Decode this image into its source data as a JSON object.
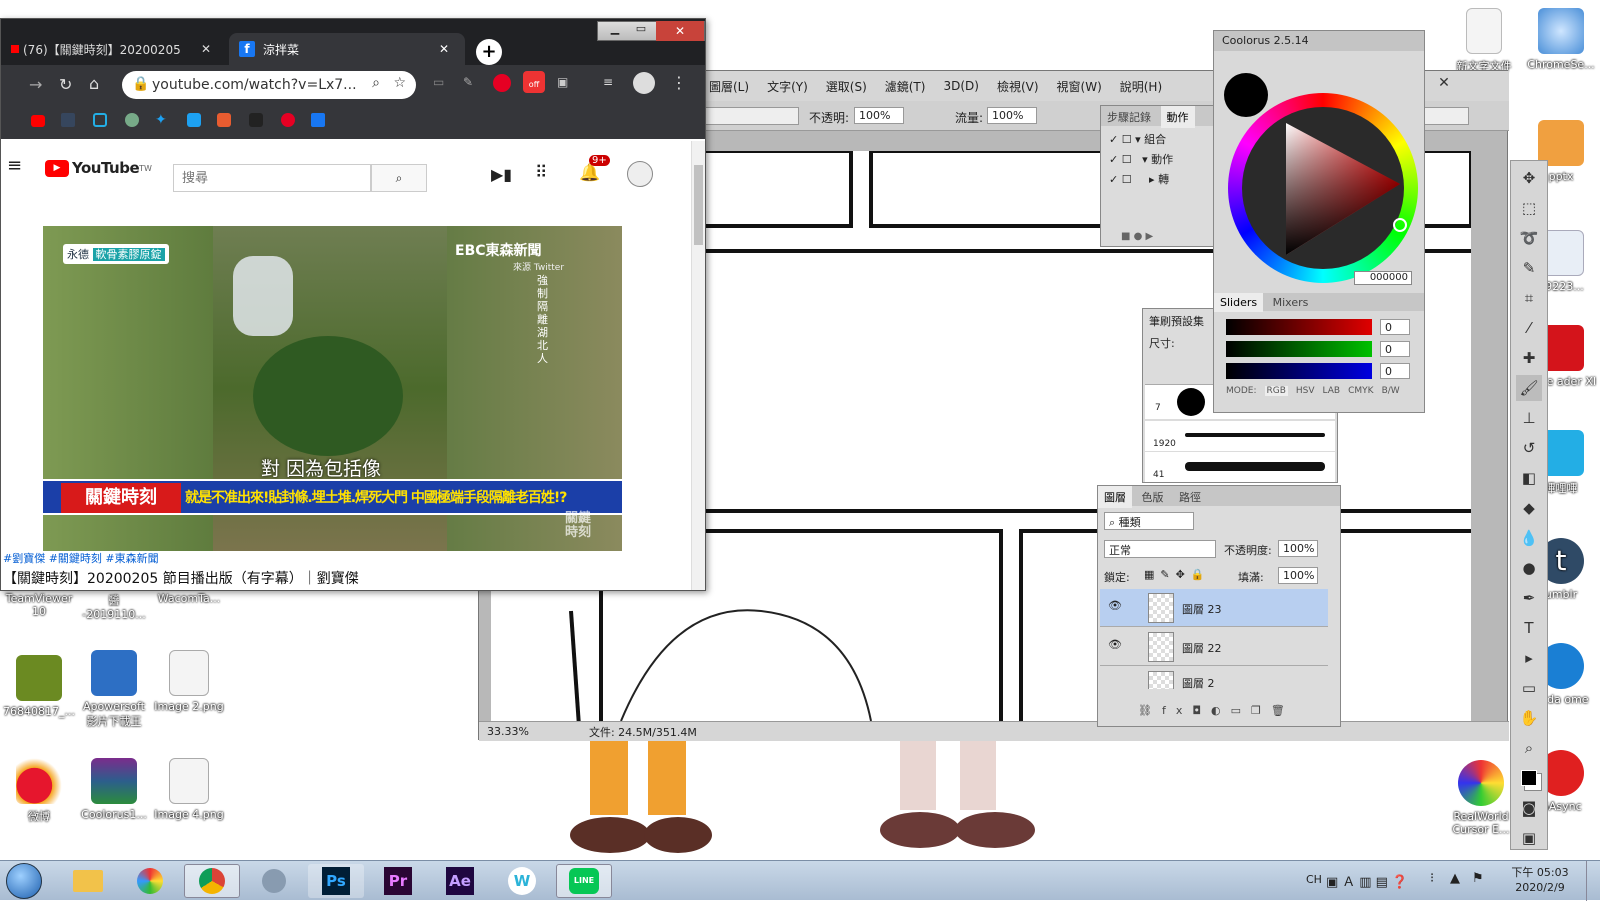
{
  "desktop": {
    "icons_right": [
      {
        "label": "新文字文件"
      },
      {
        "label": "ChromeSe..."
      }
    ],
    "icons_right_partial": [
      "2019110...",
      "pptx",
      "39223...",
      "dobe\nader XI",
      "嗶哩嗶",
      "umblr",
      "anda\nome",
      "GAsync"
    ],
    "icons_left": [
      {
        "label": "TeamViewer\n10"
      },
      {
        "label": "醬\n-2019110..."
      },
      {
        "label": "WacomTa..."
      },
      {
        "label": "76840817_..."
      },
      {
        "label": "Apowersoft\n影片下載王"
      },
      {
        "label": "Image 2.png"
      },
      {
        "label": "微博"
      },
      {
        "label": "Coolorus1..."
      },
      {
        "label": "Image 4.png"
      }
    ],
    "icons_bottom_right": [
      {
        "label": "RealWorld\nCursor E..."
      }
    ]
  },
  "photoshop": {
    "menu": [
      "圖層(L)",
      "文字(Y)",
      "選取(S)",
      "濾鏡(T)",
      "3D(D)",
      "檢視(V)",
      "視窗(W)",
      "說明(H)"
    ],
    "options": {
      "opacity_label": "不透明:",
      "opacity": "100%",
      "flow_label": "流量:",
      "flow": "100%"
    },
    "status": {
      "zoom": "33.33%",
      "doc": "文件: 24.5M/351.4M"
    },
    "actions_panel": {
      "tabs": [
        "步驟記錄",
        "動作"
      ],
      "rows": [
        "組合",
        "動作",
        "轉"
      ]
    },
    "brush_panel": {
      "title": "筆刷預設集",
      "size_label": "尺寸:",
      "presets": [
        {
          "num": "7"
        },
        {
          "num": "1920"
        },
        {
          "num": "41"
        }
      ]
    },
    "layers_panel": {
      "tabs": [
        "圖層",
        "色版",
        "路徑"
      ],
      "kind": "種類",
      "blend": "正常",
      "opacity_label": "不透明度:",
      "opacity": "100%",
      "lock_label": "鎖定:",
      "fill_label": "填滿:",
      "fill": "100%",
      "layers": [
        {
          "name": "圖層 23",
          "selected": true
        },
        {
          "name": "圖層 22",
          "selected": false
        },
        {
          "name": "圖層 2",
          "selected": false
        }
      ]
    },
    "coolorus": {
      "title": "Coolorus 2.5.14",
      "hex": "000000",
      "tabs": [
        "Sliders",
        "Mixers"
      ],
      "sliders": [
        {
          "value": "0"
        },
        {
          "value": "0"
        },
        {
          "value": "0"
        }
      ],
      "modes": [
        "MODE:",
        "RGB",
        "HSV",
        "LAB",
        "CMYK",
        "B/W"
      ],
      "slider_colors": [
        "#e00000",
        "#00c000",
        "#0000e0"
      ]
    }
  },
  "chrome": {
    "tabs": [
      {
        "title": "(76)【關鍵時刻】20200205",
        "active": false
      },
      {
        "title": "涼拌菜",
        "active": true
      }
    ],
    "url": "youtube.com/watch?v=Lx7...",
    "youtube": {
      "logo": "YouTube",
      "logo_sup": "TW",
      "search_placeholder": "搜尋",
      "notif_count": "9+",
      "video": {
        "sponsor": "永德",
        "sponsor_sub": "軟骨素膠原錠",
        "channel": "EBC東森新聞",
        "source": "來源 Twitter",
        "vertical_text": "強制隔離湖北人",
        "subtitle": "對 因為包括像",
        "banner_show": "關鍵時刻",
        "banner_headline": "就是不准出來!貼封條.埋土堆.焊死大門 中國極端手段隔離老百姓!?",
        "watermark": "關鍵\n時刻"
      },
      "hashtags": "#劉寶傑 #關鍵時刻 #東森新聞",
      "video_title": "【關鍵時刻】20200205 節目播出版（有字幕）｜劉寶傑"
    }
  },
  "taskbar": {
    "apps": [
      "Ps",
      "Pr",
      "Ae"
    ],
    "tray_lang": "CH",
    "clock_time": "下午 05:03",
    "clock_date": "2020/2/9"
  }
}
